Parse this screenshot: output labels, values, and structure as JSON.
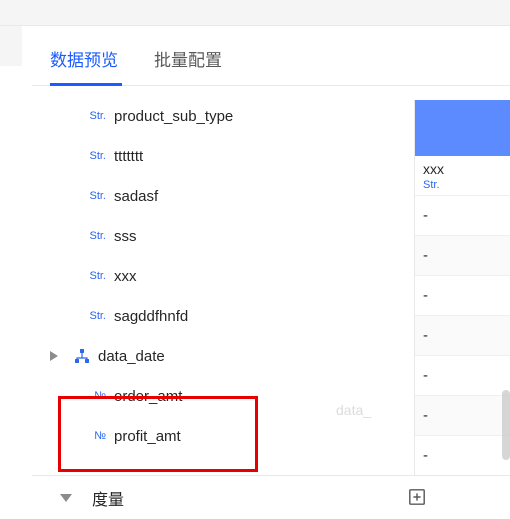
{
  "tabs": {
    "preview": "数据预览",
    "batch": "批量配置"
  },
  "type_labels": {
    "string": "Str.",
    "number": "№"
  },
  "fields": [
    {
      "type": "string",
      "name": "product_sub_type"
    },
    {
      "type": "string",
      "name": "ttttttt",
      "has_gear": true
    },
    {
      "type": "string",
      "name": "sadasf"
    },
    {
      "type": "string",
      "name": "sss"
    },
    {
      "type": "string",
      "name": "xxx"
    },
    {
      "type": "string",
      "name": "sagddfhnfd"
    },
    {
      "type": "group",
      "name": "data_date"
    },
    {
      "type": "number",
      "name": "order_amt"
    },
    {
      "type": "number",
      "name": "profit_amt"
    }
  ],
  "right_panel": {
    "header_value": "xxx",
    "header_sub": "Str.",
    "cells": [
      "-",
      "-",
      "-",
      "-",
      "-",
      "-",
      "-"
    ]
  },
  "ghost_text": "data_",
  "footer": {
    "section": "度量"
  }
}
